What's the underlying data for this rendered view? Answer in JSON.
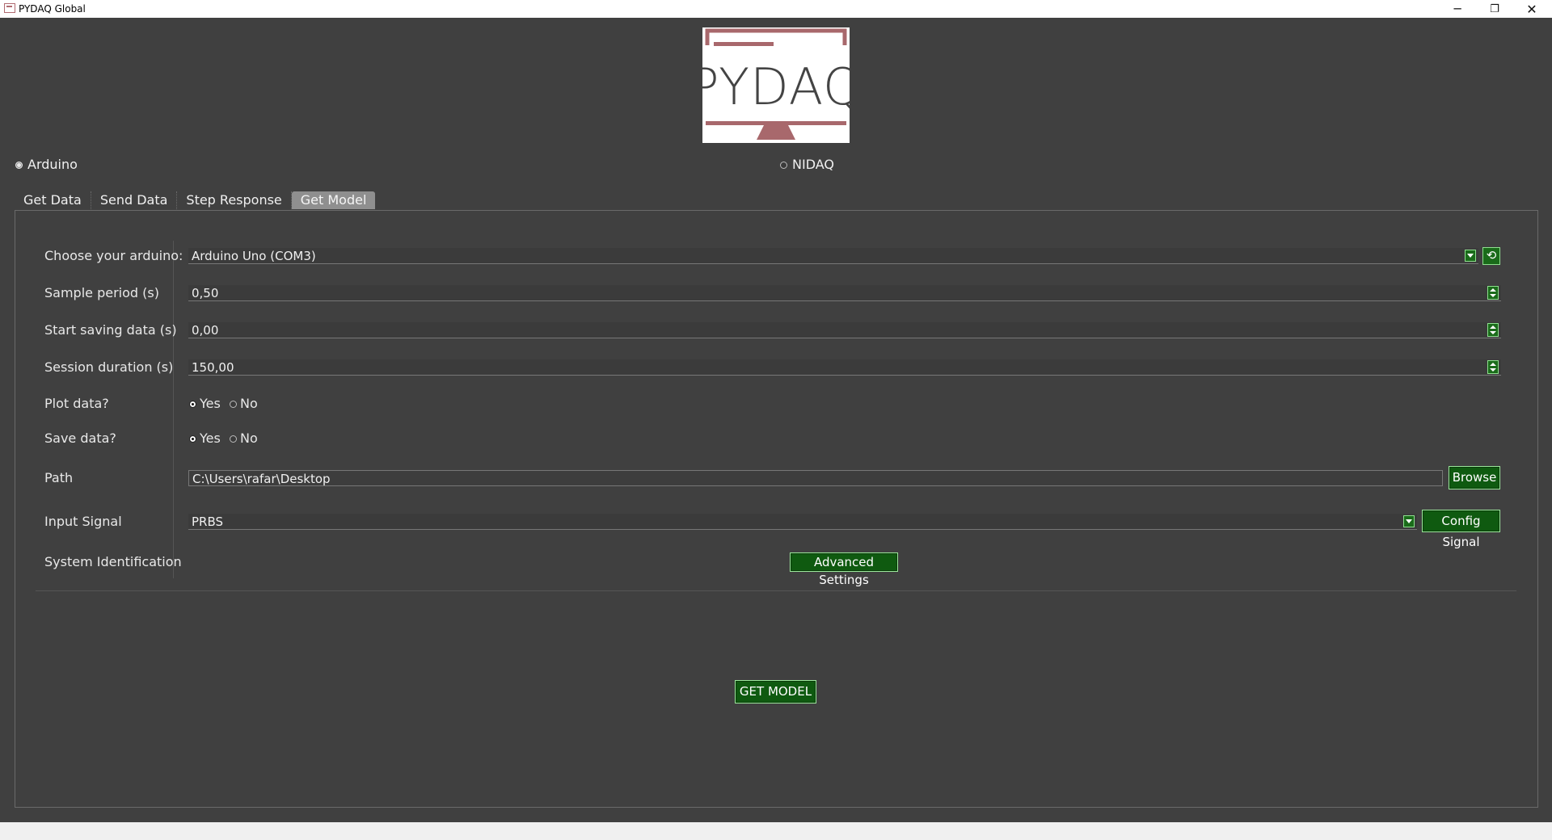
{
  "window": {
    "title": "PYDAQ Global",
    "minimize_glyph": "─",
    "maximize_glyph": "❐",
    "close_glyph": "✕"
  },
  "logo": {
    "text": "PYDAQ"
  },
  "board": {
    "arduino_label": "Arduino",
    "nidaq_label": "NIDAQ",
    "selected": "Arduino"
  },
  "tabs": [
    {
      "label": "Get Data"
    },
    {
      "label": "Send Data"
    },
    {
      "label": "Step Response"
    },
    {
      "label": "Get Model"
    }
  ],
  "active_tab": "Get Model",
  "form": {
    "arduino": {
      "label": "Choose your arduino:",
      "value": "Arduino Uno (COM3)",
      "refresh_icon": "⟲"
    },
    "sample_period": {
      "label": "Sample period (s)",
      "value": "0,50"
    },
    "start_saving": {
      "label": "Start saving data (s)",
      "value": "0,00"
    },
    "session_duration": {
      "label": "Session duration (s)",
      "value": "150,00"
    },
    "plot_data": {
      "label": "Plot data?",
      "yes": "Yes",
      "no": "No",
      "selected": "Yes"
    },
    "save_data": {
      "label": "Save data?",
      "yes": "Yes",
      "no": "No",
      "selected": "Yes"
    },
    "path": {
      "label": "Path",
      "value": "C:\\Users\\rafar\\Desktop",
      "browse": "Browse"
    },
    "input_signal": {
      "label": "Input Signal",
      "value": "PRBS",
      "config": "Config Signal"
    },
    "system_identification": {
      "label": "System Identification",
      "advanced": "Advanced Settings"
    }
  },
  "actions": {
    "get_model": "GET MODEL"
  },
  "colors": {
    "background": "#404040",
    "button_green": "#0f5a10",
    "button_border": "#9be89b",
    "logo_accent": "#a8686c"
  }
}
